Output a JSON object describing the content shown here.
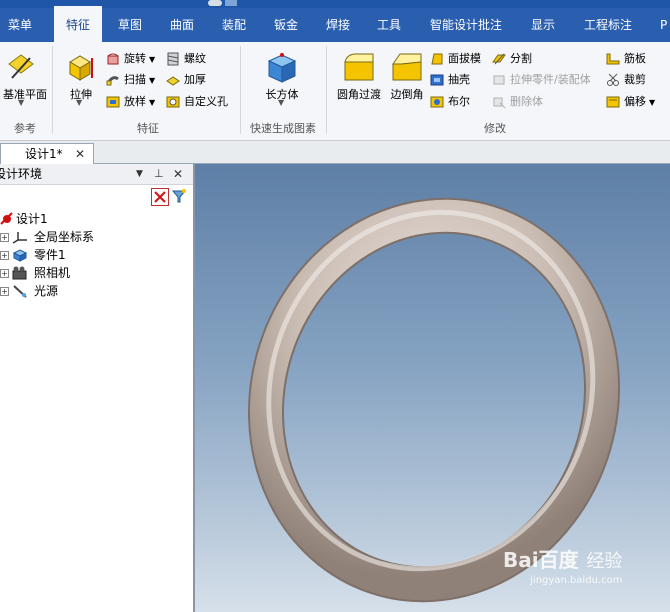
{
  "menu": {
    "items": [
      "菜单",
      "特征",
      "草图",
      "曲面",
      "装配",
      "钣金",
      "焊接",
      "工具",
      "智能设计批注",
      "显示",
      "工程标注",
      "P"
    ],
    "active": "特征"
  },
  "ribbon": {
    "reference": {
      "label": "基准平面",
      "group": "参考"
    },
    "feature": {
      "extrude": "拉伸",
      "rotate": "旋转",
      "sweep": "扫描",
      "loft": "放样",
      "thread": "螺纹",
      "thicken": "加厚",
      "custom_hole": "自定义孔",
      "group": "特征"
    },
    "quick": {
      "cuboid": "长方体",
      "group": "快速生成图素"
    },
    "modify": {
      "fillet": "圆角过渡",
      "chamfer": "边倒角",
      "face_draft": "面拔模",
      "shell": "抽壳",
      "boolean": "布尔",
      "split": "分割",
      "stretch_part": "拉伸零件/装配体",
      "delete_body": "删除体",
      "rib": "筋板",
      "trim": "裁剪",
      "offset": "偏移",
      "group": "修改"
    }
  },
  "tabs": {
    "document": "设计1*"
  },
  "panel": {
    "title": "设计环境",
    "tree": [
      "设计1",
      "全局坐标系",
      "零件1",
      "照相机",
      "光源"
    ]
  },
  "watermark": {
    "brand": "Bai百度",
    "text": "经验",
    "url": "jingyan.baidu.com"
  },
  "colors": {
    "menubar": "#2a5fb0",
    "active_tab": "#f4f6f9",
    "torus": "#c9bcb3"
  }
}
